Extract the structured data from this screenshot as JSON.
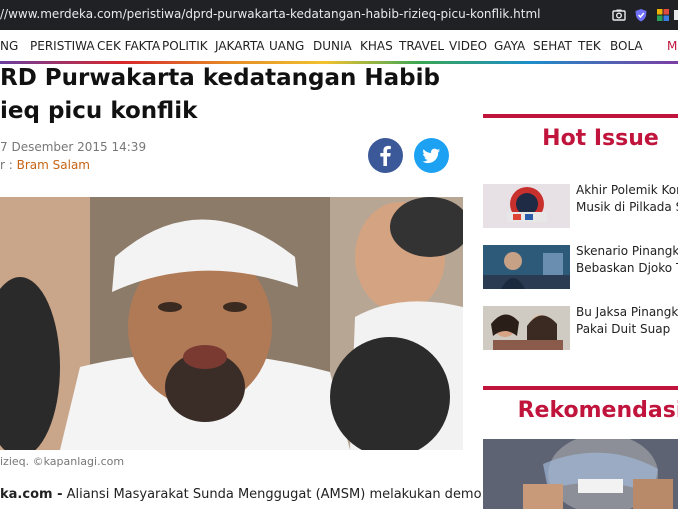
{
  "browser": {
    "url": "//www.merdeka.com/peristiwa/dprd-purwakarta-kedatangan-habib-rizieq-picu-konflik.html"
  },
  "nav": {
    "items": [
      "NG",
      "PERISTIWA",
      "CEK FAKTA",
      "POLITIK",
      "JAKARTA",
      "UANG",
      "DUNIA",
      "KHAS",
      "TRAVEL",
      "VIDEO",
      "GAYA",
      "SEHAT",
      "TEK",
      "BOLA",
      "MO"
    ]
  },
  "article": {
    "title_line1": "RD Purwakarta kedatangan Habib",
    "title_line2": "ieq picu konflik",
    "date": "7 Desember 2015 14:39",
    "author_prefix": "r : ",
    "author": "Bram Salam",
    "caption": "izieq. ©kapanlagi.com",
    "lead_source": "ka.com -",
    "lead_text": " Aliansi Masyarakat Sunda Menggugat (AMSM) melakukan demo ke"
  },
  "sidebar": {
    "hot_title": "Hot Issue",
    "hot_items": [
      {
        "line1": "Akhir Polemik Konse",
        "line2": "Musik di Pilkada Ser"
      },
      {
        "line1": "Skenario Pinangki",
        "line2": "Bebaskan Djoko Tja"
      },
      {
        "line1": "Bu Jaksa Pinangki B",
        "line2": "Pakai Duit Suap"
      }
    ],
    "rek_title": "Rekomendasi"
  },
  "colors": {
    "accent": "#c0143c",
    "author": "#c66414",
    "facebook": "#3b5998",
    "twitter": "#1da1f2"
  },
  "icons": [
    "screenshot-icon",
    "shield-extension-icon",
    "extension-icon",
    "puzzle-icon",
    "facebook-icon",
    "twitter-icon"
  ]
}
